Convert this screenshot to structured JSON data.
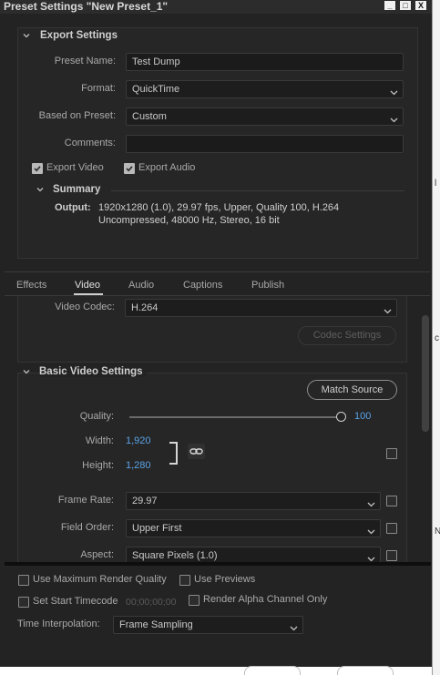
{
  "window": {
    "title": "Preset Settings \"New Preset_1\"",
    "controls": [
      "_",
      "□",
      "X"
    ]
  },
  "export_settings": {
    "title": "Export Settings",
    "preset_name_label": "Preset Name:",
    "preset_name_value": "Test Dump",
    "format_label": "Format:",
    "format_value": "QuickTime",
    "based_on_label": "Based on Preset:",
    "based_on_value": "Custom",
    "comments_label": "Comments:",
    "comments_value": "",
    "export_video_label": "Export Video",
    "export_video_checked": true,
    "export_audio_label": "Export Audio",
    "export_audio_checked": true
  },
  "summary": {
    "title": "Summary",
    "output_label": "Output:",
    "output_line1": "1920x1280 (1.0), 29.97 fps, Upper, Quality 100, H.264",
    "output_line2": "Uncompressed, 48000 Hz, Stereo, 16 bit"
  },
  "tabs": [
    {
      "label": "Effects",
      "active": false
    },
    {
      "label": "Video",
      "active": true
    },
    {
      "label": "Audio",
      "active": false
    },
    {
      "label": "Captions",
      "active": false
    },
    {
      "label": "Publish",
      "active": false
    }
  ],
  "video": {
    "codec_label": "Video Codec:",
    "codec_value": "H.264",
    "codec_settings_button": "Codec Settings"
  },
  "basic_video": {
    "title": "Basic Video Settings",
    "match_source_button": "Match Source",
    "quality_label": "Quality:",
    "quality_value": "100",
    "quality_fraction": 1.0,
    "width_label": "Width:",
    "width_value": "1,920",
    "height_label": "Height:",
    "height_value": "1,280",
    "frame_rate_label": "Frame Rate:",
    "frame_rate_value": "29.97",
    "field_order_label": "Field Order:",
    "field_order_value": "Upper First",
    "aspect_label": "Aspect:",
    "aspect_value": "Square Pixels (1.0)"
  },
  "bottom": {
    "max_render_quality_label": "Use Maximum Render Quality",
    "use_previews_label": "Use Previews",
    "set_start_timecode_label": "Set Start Timecode",
    "timecode_value": "00;00;00;00",
    "render_alpha_label": "Render Alpha Channel Only",
    "time_interp_label": "Time Interpolation:",
    "time_interp_value": "Frame Sampling"
  },
  "right_strip_marks": [
    "l",
    "c",
    "N"
  ],
  "colors": {
    "background": "#232323",
    "panel": "#262626",
    "accent_blue": "#5ba3e6",
    "text": "#b8b8b8"
  }
}
